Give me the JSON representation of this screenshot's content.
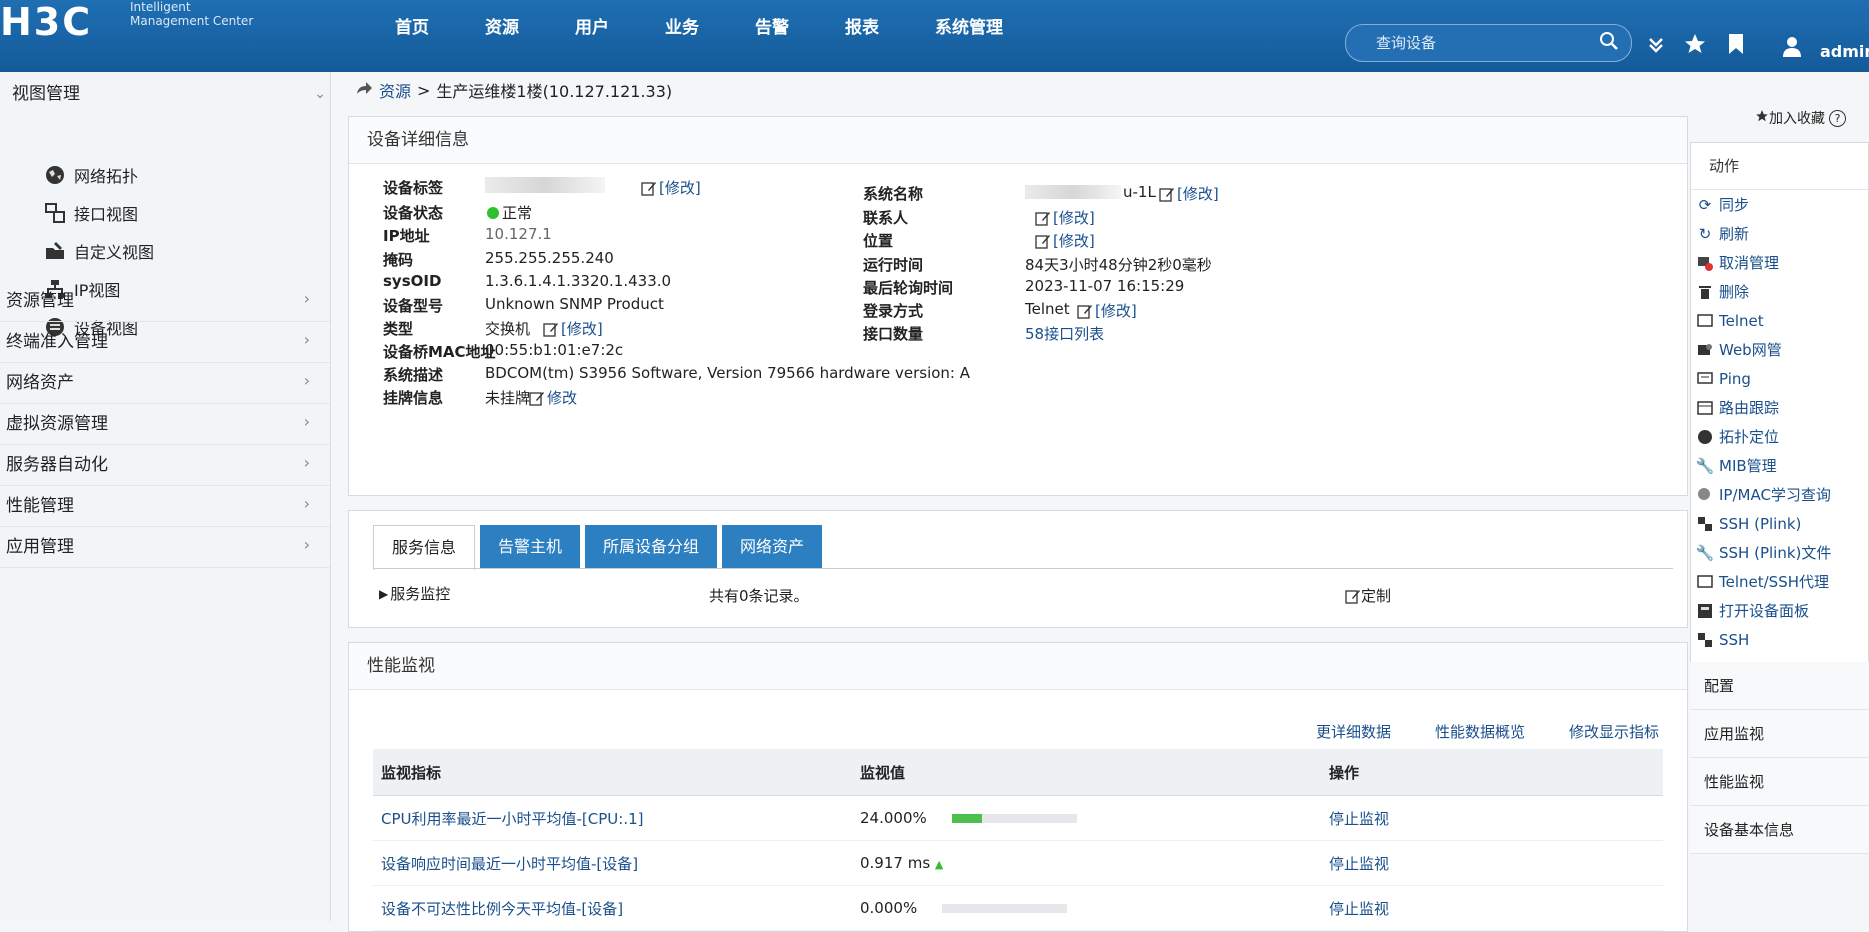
{
  "header": {
    "logo": "H3C",
    "logo_sub": [
      "Intelligent",
      "Management Center"
    ],
    "nav": [
      "首页",
      "资源",
      "用户",
      "业务",
      "告警",
      "报表",
      "系统管理"
    ],
    "search_placeholder": "查询设备",
    "user": "admin"
  },
  "sidebar": {
    "group_title": "视图管理",
    "sub_items": [
      "网络拓扑",
      "接口视图",
      "自定义视图",
      "IP视图",
      "设备视图"
    ],
    "items": [
      "资源管理",
      "终端准入管理",
      "网络资产",
      "虚拟资源管理",
      "服务器自动化",
      "性能管理",
      "应用管理"
    ]
  },
  "breadcrumb": {
    "root": "资源",
    "separator": ">",
    "current": "生产运维楼1楼(10.127.121.33)"
  },
  "add_favorite": "加入收藏",
  "detail": {
    "title": "设备详细信息",
    "edit_label": "[修改]",
    "left": [
      {
        "label": "设备标签",
        "value": ""
      },
      {
        "label": "设备状态",
        "value": "正常"
      },
      {
        "label": "IP地址",
        "value": "10.127.1"
      },
      {
        "label": "掩码",
        "value": "255.255.255.240"
      },
      {
        "label": "sysOID",
        "value": "1.3.6.1.4.1.3320.1.433.0"
      },
      {
        "label": "设备型号",
        "value": "Unknown SNMP Product"
      },
      {
        "label": "类型",
        "value": "交换机"
      },
      {
        "label": "设备桥MAC地址",
        "value": "00:55:b1:01:e7:2c"
      },
      {
        "label": "系统描述",
        "value": "BDCOM(tm) S3956 Software, Version 79566 hardware version: A"
      },
      {
        "label": "挂牌信息",
        "value": "未挂牌"
      }
    ],
    "hang_edit": "修改",
    "right": [
      {
        "label": "系统名称",
        "value": "u-1L"
      },
      {
        "label": "联系人",
        "value": ""
      },
      {
        "label": "位置",
        "value": ""
      },
      {
        "label": "运行时间",
        "value": "84天3小时48分钟2秒0毫秒"
      },
      {
        "label": "最后轮询时间",
        "value": "2023-11-07 16:15:29"
      },
      {
        "label": "登录方式",
        "value": "Telnet"
      },
      {
        "label": "接口数量",
        "value": "58接口列表"
      }
    ]
  },
  "tabs": {
    "items": [
      "服务信息",
      "告警主机",
      "所属设备分组",
      "网络资产"
    ],
    "service_monitor": "服务监控",
    "record_count": "共有0条记录。",
    "customize": "定制"
  },
  "perf": {
    "title": "性能监视",
    "links": [
      "更详细数据",
      "性能数据概览",
      "修改显示指标"
    ],
    "columns": [
      "监视指标",
      "监视值",
      "操作"
    ],
    "rows": [
      {
        "metric": "CPU利用率最近一小时平均值-[CPU:.1]",
        "value": "24.000%",
        "bar": 0.24,
        "op": "停止监视"
      },
      {
        "metric": "设备响应时间最近一小时平均值-[设备]",
        "value": "0.917 ms",
        "trend": "▲",
        "op": "停止监视"
      },
      {
        "metric": "设备不可达性比例今天平均值-[设备]",
        "value": "0.000%",
        "bar": 0,
        "op": "停止监视"
      }
    ]
  },
  "actions": {
    "title": "动作",
    "items": [
      "同步",
      "刷新",
      "取消管理",
      "删除",
      "Telnet",
      "Web网管",
      "Ping",
      "路由跟踪",
      "拓扑定位",
      "MIB管理",
      "IP/MAC学习查询",
      "SSH (Plink)",
      "SSH (Plink)文件",
      "Telnet/SSH代理",
      "打开设备面板",
      "SSH"
    ],
    "sections": [
      "配置",
      "应用监视",
      "性能监视",
      "设备基本信息"
    ]
  },
  "colors": {
    "header": "#1f6fb3",
    "tab": "#2c7fc1",
    "link": "#1a4f8c",
    "status_ok": "#2fbf2f",
    "bar_fill": "#4cbf4c"
  }
}
